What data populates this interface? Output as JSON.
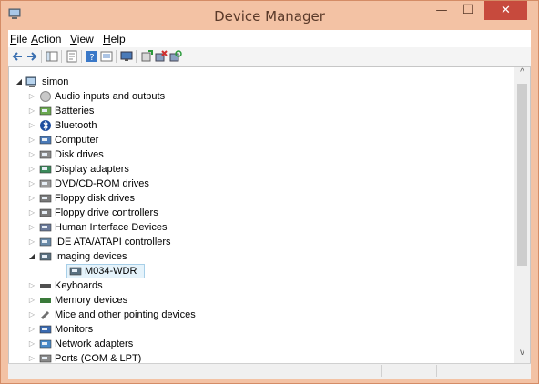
{
  "window": {
    "title": "Device Manager",
    "minimize_glyph": "—",
    "maximize_glyph": "☐",
    "close_glyph": "✕"
  },
  "menu": [
    {
      "label": "File",
      "accel": "F",
      "rest": "ile"
    },
    {
      "label": "Action",
      "accel": "A",
      "rest": "ction"
    },
    {
      "label": "View",
      "accel": "V",
      "rest": "iew"
    },
    {
      "label": "Help",
      "accel": "H",
      "rest": "elp"
    }
  ],
  "toolbar": {
    "icons": [
      "back-icon",
      "forward-icon",
      "show-hide-tree-icon",
      "properties-icon",
      "help-icon",
      "view-icon",
      "monitor-icon",
      "update-driver-icon",
      "disable-device-icon",
      "scan-hardware-icon"
    ]
  },
  "tree": {
    "root": {
      "label": "simon",
      "expanded": true,
      "icon": "computer-icon"
    },
    "items": [
      {
        "label": "Audio inputs and outputs",
        "icon": "speaker-icon",
        "level": 1,
        "expanded": false
      },
      {
        "label": "Batteries",
        "icon": "battery-icon",
        "level": 1,
        "expanded": false
      },
      {
        "label": "Bluetooth",
        "icon": "bluetooth-icon",
        "level": 1,
        "expanded": false
      },
      {
        "label": "Computer",
        "icon": "computer-icon",
        "level": 1,
        "expanded": false
      },
      {
        "label": "Disk drives",
        "icon": "disk-drive-icon",
        "level": 1,
        "expanded": false
      },
      {
        "label": "Display adapters",
        "icon": "display-adapter-icon",
        "level": 1,
        "expanded": false
      },
      {
        "label": "DVD/CD-ROM drives",
        "icon": "dvd-drive-icon",
        "level": 1,
        "expanded": false
      },
      {
        "label": "Floppy disk drives",
        "icon": "floppy-drive-icon",
        "level": 1,
        "expanded": false
      },
      {
        "label": "Floppy drive controllers",
        "icon": "floppy-controller-icon",
        "level": 1,
        "expanded": false
      },
      {
        "label": "Human Interface Devices",
        "icon": "hid-icon",
        "level": 1,
        "expanded": false
      },
      {
        "label": "IDE ATA/ATAPI controllers",
        "icon": "ide-controller-icon",
        "level": 1,
        "expanded": false
      },
      {
        "label": "Imaging devices",
        "icon": "imaging-device-icon",
        "level": 1,
        "expanded": true
      },
      {
        "label": "M034-WDR",
        "icon": "camera-device-icon",
        "level": 2,
        "selected": true
      },
      {
        "label": "Keyboards",
        "icon": "keyboard-icon",
        "level": 1,
        "expanded": false
      },
      {
        "label": "Memory devices",
        "icon": "memory-icon",
        "level": 1,
        "expanded": false
      },
      {
        "label": "Mice and other pointing devices",
        "icon": "mouse-icon",
        "level": 1,
        "expanded": false
      },
      {
        "label": "Monitors",
        "icon": "monitor-icon",
        "level": 1,
        "expanded": false
      },
      {
        "label": "Network adapters",
        "icon": "network-adapter-icon",
        "level": 1,
        "expanded": false
      },
      {
        "label": "Ports (COM & LPT)",
        "icon": "port-icon",
        "level": 1,
        "expanded": false
      }
    ]
  },
  "scrollbar": {
    "up_glyph": "^",
    "down_glyph": "v"
  },
  "colors": {
    "frame": "#f3c2a4",
    "close_button": "#c74a3d",
    "selection_fill": "#e5f3fb",
    "selection_border": "#a7cfe8"
  }
}
